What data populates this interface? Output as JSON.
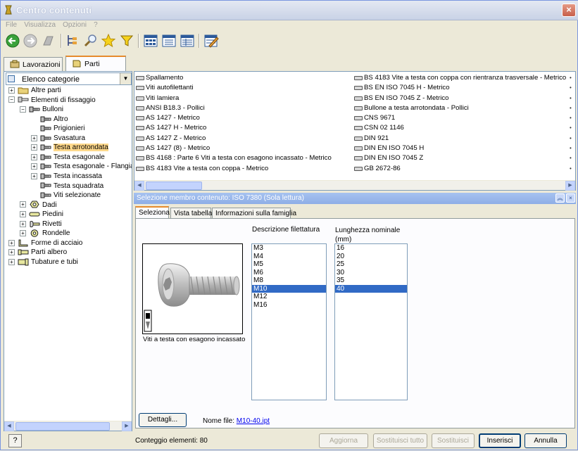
{
  "window": {
    "title": "Centro contenuti",
    "close": "×"
  },
  "menu": [
    "File",
    "Visualizza",
    "Opzioni",
    "?"
  ],
  "tabs": [
    {
      "label": "Lavorazioni"
    },
    {
      "label": "Parti"
    }
  ],
  "category_combo": {
    "value": "Elenco categorie"
  },
  "tree": [
    {
      "label": "Altre parti",
      "exp": "+",
      "lvl": 0,
      "icon": "folder"
    },
    {
      "label": "Elementi di fissaggio",
      "exp": "−",
      "lvl": 0,
      "icon": "fastener"
    },
    {
      "label": "Bulloni",
      "exp": "−",
      "lvl": 1,
      "icon": "bolt"
    },
    {
      "label": "Altro",
      "exp": "",
      "lvl": 2,
      "icon": "bolt"
    },
    {
      "label": "Prigionieri",
      "exp": "",
      "lvl": 2,
      "icon": "bolt"
    },
    {
      "label": "Svasatura",
      "exp": "+",
      "lvl": 2,
      "icon": "bolt"
    },
    {
      "label": "Testa arrotondata",
      "exp": "+",
      "lvl": 2,
      "icon": "bolt",
      "selected": true
    },
    {
      "label": "Testa esagonale",
      "exp": "+",
      "lvl": 2,
      "icon": "bolt"
    },
    {
      "label": "Testa esagonale - Flangiato",
      "exp": "+",
      "lvl": 2,
      "icon": "bolt"
    },
    {
      "label": "Testa incassata",
      "exp": "+",
      "lvl": 2,
      "icon": "bolt"
    },
    {
      "label": "Testa squadrata",
      "exp": "",
      "lvl": 2,
      "icon": "bolt"
    },
    {
      "label": "Viti selezionate",
      "exp": "",
      "lvl": 2,
      "icon": "bolt"
    },
    {
      "label": "Dadi",
      "exp": "+",
      "lvl": 1,
      "icon": "nut"
    },
    {
      "label": "Piedini",
      "exp": "+",
      "lvl": 1,
      "icon": "pin"
    },
    {
      "label": "Rivetti",
      "exp": "+",
      "lvl": 1,
      "icon": "rivet"
    },
    {
      "label": "Rondelle",
      "exp": "+",
      "lvl": 1,
      "icon": "washer"
    },
    {
      "label": "Forme di acciaio",
      "exp": "+",
      "lvl": 0,
      "icon": "steel"
    },
    {
      "label": "Parti albero",
      "exp": "+",
      "lvl": 0,
      "icon": "shaft"
    },
    {
      "label": "Tubature e tubi",
      "exp": "+",
      "lvl": 0,
      "icon": "pipe"
    }
  ],
  "list_col1": [
    "Spallamento",
    "Viti autofilettanti",
    "Viti lamiera",
    "ANSI B18.3 - Pollici",
    "AS 1427  - Metrico",
    "AS 1427  H  - Metrico",
    "AS 1427  Z  - Metrico",
    "AS 1427 (8)  - Metrico",
    "BS 4168 : Parte 6  Viti a testa con esagono incassato  - Metrico",
    "BS 4183  Vite a testa con coppa  - Metrico"
  ],
  "list_col2": [
    "BS 4183  Vite a testa con coppa con rientranza trasversale  - Metrico",
    "BS EN ISO 7045 H  - Metrico",
    "BS EN ISO 7045 Z  - Metrico",
    "Bullone a testa arrotondata - Pollici",
    "CNS 9671",
    "CSN 02 1146",
    "DIN 921",
    "DIN EN ISO 7045  H",
    "DIN EN ISO 7045  Z",
    "GB 2672-86"
  ],
  "selection_header": "Selezione membro contenuto:  ISO 7380 (Sola lettura)",
  "inner_tabs": [
    "Seleziona",
    "Vista tabella",
    "Informazioni sulla famiglia"
  ],
  "image_caption": "Viti a testa con esagono incassato",
  "thread_label": "Descrizione filettatura",
  "thread_options": [
    "M3",
    "M4",
    "M5",
    "M6",
    "M8",
    "M10",
    "M12",
    "M16"
  ],
  "thread_selected": "M10",
  "length_label_1": "Lunghezza nominale",
  "length_label_2": "(mm)",
  "length_options": [
    "16",
    "20",
    "25",
    "30",
    "35",
    "40"
  ],
  "length_selected": "40",
  "details_button": "Dettagli...",
  "file_label": "Nome file:",
  "file_name": "M10-40.ipt",
  "status": {
    "help": "?",
    "count": "Conteggio elementi: 80",
    "buttons": [
      {
        "label": "Aggiorna",
        "enabled": false
      },
      {
        "label": "Sostituisci tutto",
        "enabled": false
      },
      {
        "label": "Sostituisci",
        "enabled": false
      },
      {
        "label": "Inserisci",
        "enabled": true,
        "default": true
      },
      {
        "label": "Annulla",
        "enabled": true
      }
    ]
  },
  "colors": {
    "selection": "#316ac5",
    "tree_highlight": "#ffd98c",
    "header": "#8eaee6"
  }
}
